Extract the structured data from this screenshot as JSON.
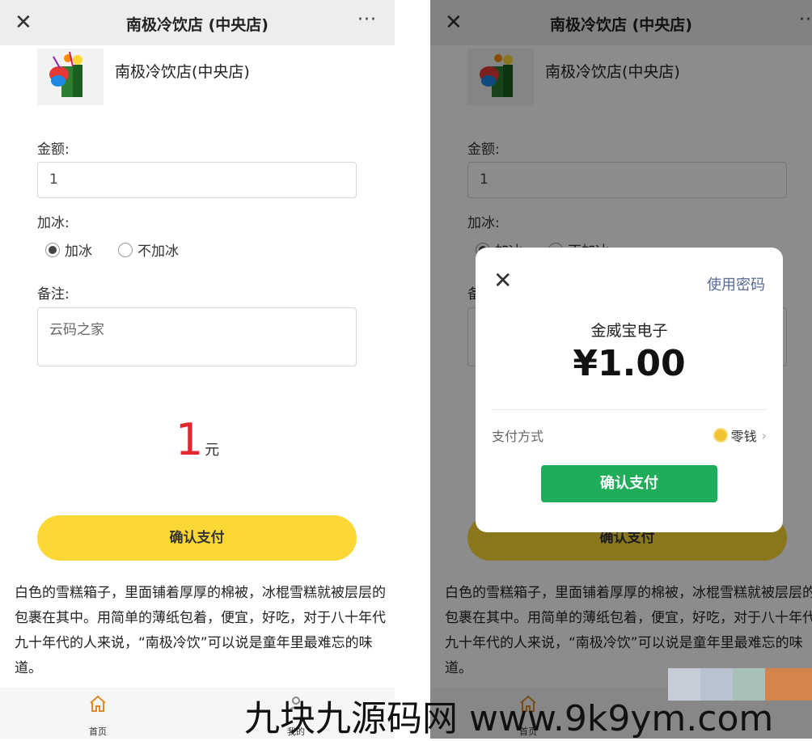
{
  "left": {
    "nav": {
      "close": "✕",
      "title": "南极冷饮店 (中央店)",
      "more": "···"
    },
    "shop_name": "南极冷饮店(中央店)",
    "amount_label": "金额:",
    "amount_value": "1",
    "ice_label": "加冰:",
    "ice_options": [
      {
        "label": "加冰",
        "checked": true
      },
      {
        "label": "不加冰",
        "checked": false
      }
    ],
    "note_label": "备注:",
    "note_value": "云码之家",
    "total_number": "1",
    "total_unit": "元",
    "confirm_label": "确认支付",
    "description": "白色的雪糕箱子，里面铺着厚厚的棉被，冰棍雪糕就被层层的包裹在其中。用简单的薄纸包着，便宜，好吃，对于八十年代九十年代的人来说，“南极冷饮”可以说是童年里最难忘的味道。",
    "tabs": [
      {
        "icon": "home-icon",
        "label": "首页"
      },
      {
        "icon": "user-icon",
        "label": "我的"
      }
    ]
  },
  "right": {
    "nav": {
      "close": "✕",
      "title": "南极冷饮店 (中央店)",
      "more": "···"
    },
    "shop_name": "南极冷饮店(中央店)",
    "amount_label": "金额:",
    "amount_value": "1",
    "ice_label": "加冰:",
    "ice_options": [
      {
        "label": "加冰",
        "checked": true
      },
      {
        "label": "不加冰",
        "checked": false
      }
    ],
    "note_label": "备",
    "confirm_label": "确认支付",
    "description": "白色的雪糕箱子，里面铺着厚厚的棉被，冰棍雪糕就被层层的包裹在其中。用简单的薄纸包着，便宜，好吃，对于八十年代九十年代的人来说，“南极冷饮”可以说是童年里最难忘的味道。",
    "tab_home": "首页"
  },
  "modal": {
    "close": "✕",
    "use_password": "使用密码",
    "merchant": "金威宝电子",
    "amount": "¥1.00",
    "method_label": "支付方式",
    "method_value": "零钱",
    "confirm": "确认支付"
  },
  "watermark": "九块九源码网 www.9k9ym.com",
  "colors": {
    "accent_yellow": "#fcd834",
    "price_red": "#e0262e",
    "wechat_green": "#1fad5a",
    "link_blue": "#576b95"
  }
}
